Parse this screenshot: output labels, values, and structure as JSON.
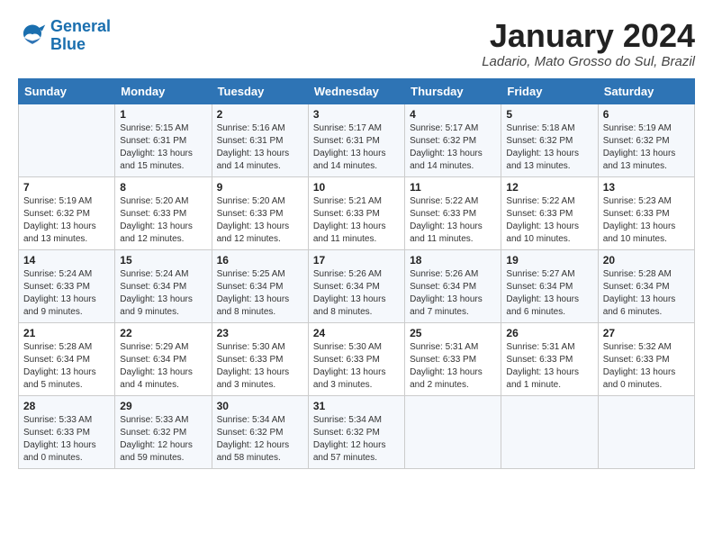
{
  "header": {
    "logo_line1": "General",
    "logo_line2": "Blue",
    "month_title": "January 2024",
    "location": "Ladario, Mato Grosso do Sul, Brazil"
  },
  "weekdays": [
    "Sunday",
    "Monday",
    "Tuesday",
    "Wednesday",
    "Thursday",
    "Friday",
    "Saturday"
  ],
  "weeks": [
    [
      {
        "day": "",
        "info": ""
      },
      {
        "day": "1",
        "info": "Sunrise: 5:15 AM\nSunset: 6:31 PM\nDaylight: 13 hours\nand 15 minutes."
      },
      {
        "day": "2",
        "info": "Sunrise: 5:16 AM\nSunset: 6:31 PM\nDaylight: 13 hours\nand 14 minutes."
      },
      {
        "day": "3",
        "info": "Sunrise: 5:17 AM\nSunset: 6:31 PM\nDaylight: 13 hours\nand 14 minutes."
      },
      {
        "day": "4",
        "info": "Sunrise: 5:17 AM\nSunset: 6:32 PM\nDaylight: 13 hours\nand 14 minutes."
      },
      {
        "day": "5",
        "info": "Sunrise: 5:18 AM\nSunset: 6:32 PM\nDaylight: 13 hours\nand 13 minutes."
      },
      {
        "day": "6",
        "info": "Sunrise: 5:19 AM\nSunset: 6:32 PM\nDaylight: 13 hours\nand 13 minutes."
      }
    ],
    [
      {
        "day": "7",
        "info": "Sunrise: 5:19 AM\nSunset: 6:32 PM\nDaylight: 13 hours\nand 13 minutes."
      },
      {
        "day": "8",
        "info": "Sunrise: 5:20 AM\nSunset: 6:33 PM\nDaylight: 13 hours\nand 12 minutes."
      },
      {
        "day": "9",
        "info": "Sunrise: 5:20 AM\nSunset: 6:33 PM\nDaylight: 13 hours\nand 12 minutes."
      },
      {
        "day": "10",
        "info": "Sunrise: 5:21 AM\nSunset: 6:33 PM\nDaylight: 13 hours\nand 11 minutes."
      },
      {
        "day": "11",
        "info": "Sunrise: 5:22 AM\nSunset: 6:33 PM\nDaylight: 13 hours\nand 11 minutes."
      },
      {
        "day": "12",
        "info": "Sunrise: 5:22 AM\nSunset: 6:33 PM\nDaylight: 13 hours\nand 10 minutes."
      },
      {
        "day": "13",
        "info": "Sunrise: 5:23 AM\nSunset: 6:33 PM\nDaylight: 13 hours\nand 10 minutes."
      }
    ],
    [
      {
        "day": "14",
        "info": "Sunrise: 5:24 AM\nSunset: 6:33 PM\nDaylight: 13 hours\nand 9 minutes."
      },
      {
        "day": "15",
        "info": "Sunrise: 5:24 AM\nSunset: 6:34 PM\nDaylight: 13 hours\nand 9 minutes."
      },
      {
        "day": "16",
        "info": "Sunrise: 5:25 AM\nSunset: 6:34 PM\nDaylight: 13 hours\nand 8 minutes."
      },
      {
        "day": "17",
        "info": "Sunrise: 5:26 AM\nSunset: 6:34 PM\nDaylight: 13 hours\nand 8 minutes."
      },
      {
        "day": "18",
        "info": "Sunrise: 5:26 AM\nSunset: 6:34 PM\nDaylight: 13 hours\nand 7 minutes."
      },
      {
        "day": "19",
        "info": "Sunrise: 5:27 AM\nSunset: 6:34 PM\nDaylight: 13 hours\nand 6 minutes."
      },
      {
        "day": "20",
        "info": "Sunrise: 5:28 AM\nSunset: 6:34 PM\nDaylight: 13 hours\nand 6 minutes."
      }
    ],
    [
      {
        "day": "21",
        "info": "Sunrise: 5:28 AM\nSunset: 6:34 PM\nDaylight: 13 hours\nand 5 minutes."
      },
      {
        "day": "22",
        "info": "Sunrise: 5:29 AM\nSunset: 6:34 PM\nDaylight: 13 hours\nand 4 minutes."
      },
      {
        "day": "23",
        "info": "Sunrise: 5:30 AM\nSunset: 6:33 PM\nDaylight: 13 hours\nand 3 minutes."
      },
      {
        "day": "24",
        "info": "Sunrise: 5:30 AM\nSunset: 6:33 PM\nDaylight: 13 hours\nand 3 minutes."
      },
      {
        "day": "25",
        "info": "Sunrise: 5:31 AM\nSunset: 6:33 PM\nDaylight: 13 hours\nand 2 minutes."
      },
      {
        "day": "26",
        "info": "Sunrise: 5:31 AM\nSunset: 6:33 PM\nDaylight: 13 hours\nand 1 minute."
      },
      {
        "day": "27",
        "info": "Sunrise: 5:32 AM\nSunset: 6:33 PM\nDaylight: 13 hours\nand 0 minutes."
      }
    ],
    [
      {
        "day": "28",
        "info": "Sunrise: 5:33 AM\nSunset: 6:33 PM\nDaylight: 13 hours\nand 0 minutes."
      },
      {
        "day": "29",
        "info": "Sunrise: 5:33 AM\nSunset: 6:32 PM\nDaylight: 12 hours\nand 59 minutes."
      },
      {
        "day": "30",
        "info": "Sunrise: 5:34 AM\nSunset: 6:32 PM\nDaylight: 12 hours\nand 58 minutes."
      },
      {
        "day": "31",
        "info": "Sunrise: 5:34 AM\nSunset: 6:32 PM\nDaylight: 12 hours\nand 57 minutes."
      },
      {
        "day": "",
        "info": ""
      },
      {
        "day": "",
        "info": ""
      },
      {
        "day": "",
        "info": ""
      }
    ]
  ]
}
